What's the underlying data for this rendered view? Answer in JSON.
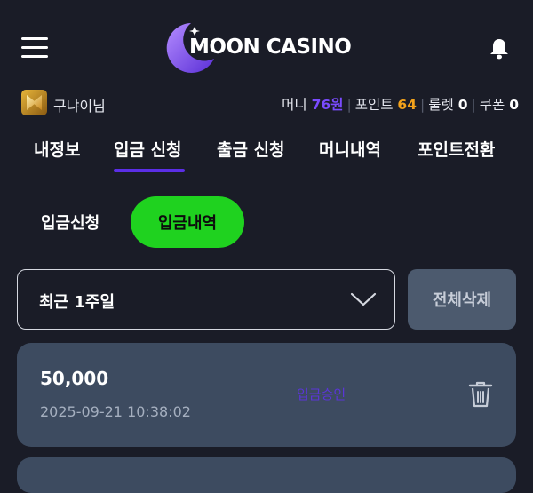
{
  "header": {
    "logo_text": "MOON CASINO",
    "menu_icon": "hamburger-icon",
    "notification_icon": "bell-icon"
  },
  "user": {
    "name": "구냐이님",
    "money_label": "머니",
    "money_value": "76원",
    "point_label": "포인트",
    "point_value": "64",
    "roulette_label": "룰렛",
    "roulette_value": "0",
    "coupon_label": "쿠폰",
    "coupon_value": "0"
  },
  "tabs": [
    {
      "label": "내정보"
    },
    {
      "label": "입금 신청",
      "active": true
    },
    {
      "label": "출금 신청"
    },
    {
      "label": "머니내역"
    },
    {
      "label": "포인트전환"
    }
  ],
  "subtabs": {
    "request": "입금신청",
    "history": "입금내역"
  },
  "filter": {
    "period_value": "최근 1주일",
    "delete_all_label": "전체삭제"
  },
  "records": [
    {
      "amount": "50,000",
      "datetime": "2025-09-21 10:38:02",
      "status": "입금승인"
    }
  ],
  "colors": {
    "background": "#1a1c27",
    "accent_purple": "#5b2ee6",
    "money": "#7a4bff",
    "point": "#f3a21b",
    "active_subtab": "#1fd21f",
    "card": "#3d4b60"
  }
}
